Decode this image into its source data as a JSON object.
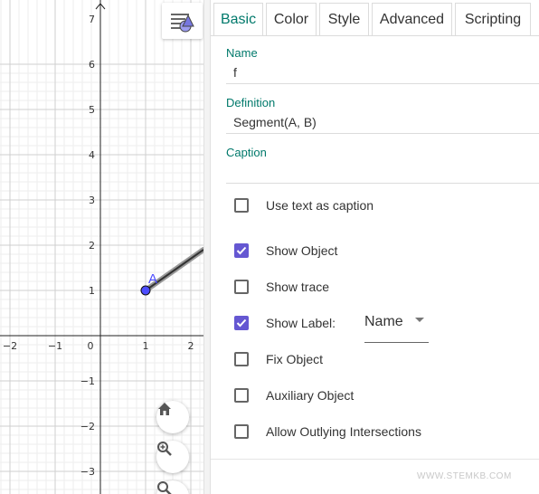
{
  "graphics": {
    "x_ticks": [
      "−2",
      "−1",
      "0",
      "1",
      "2"
    ],
    "y_ticks": [
      "7",
      "6",
      "5",
      "4",
      "3",
      "2",
      "1",
      "−1",
      "−2",
      "−3"
    ],
    "point_label": "A",
    "point_color": "#4d4dff"
  },
  "tabs": [
    {
      "label": "Basic",
      "active": true
    },
    {
      "label": "Color"
    },
    {
      "label": "Style"
    },
    {
      "label": "Advanced"
    },
    {
      "label": "Scripting"
    }
  ],
  "name_field": {
    "label": "Name",
    "value": "f"
  },
  "definition_field": {
    "label": "Definition",
    "value": "Segment(A, B)"
  },
  "caption_field": {
    "label": "Caption",
    "value": ""
  },
  "checkboxes": [
    {
      "label": "Use text as caption",
      "checked": false
    },
    {
      "label": "Show Object",
      "checked": true
    },
    {
      "label": "Show trace",
      "checked": false
    },
    {
      "label": "Show Label:",
      "checked": true
    },
    {
      "label": "Fix Object",
      "checked": false
    },
    {
      "label": "Auxiliary Object",
      "checked": false
    },
    {
      "label": "Allow Outlying Intersections",
      "checked": false
    }
  ],
  "label_select": {
    "value": "Name"
  },
  "watermark": "WWW.STEMKB.COM",
  "colors": {
    "accent": "#00796b",
    "checkbox": "#6557d2"
  }
}
